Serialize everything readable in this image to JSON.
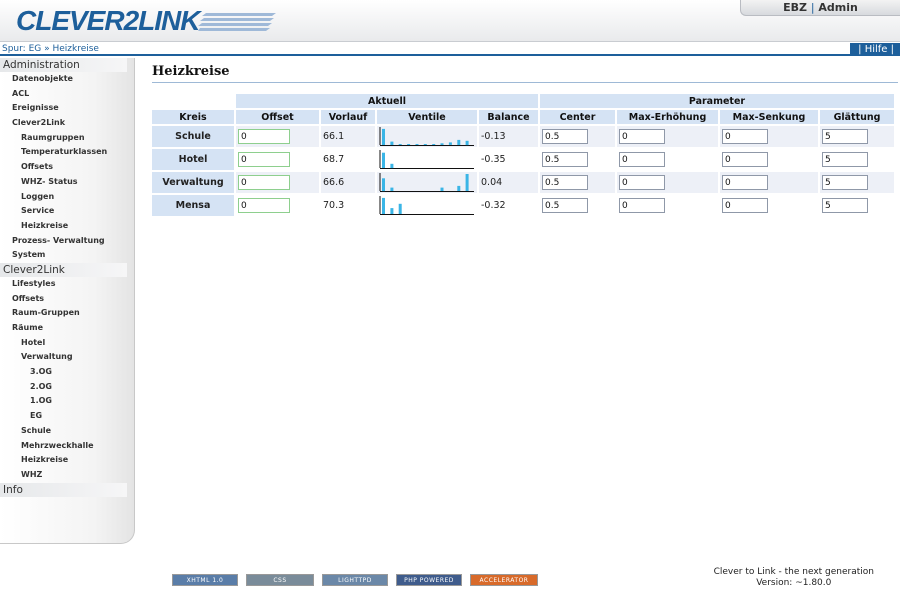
{
  "header": {
    "logo": "CLEVER2LINK",
    "user_org": "EBZ",
    "user_sep": "|",
    "user_role": "Admin",
    "brand_color": "#1d5f9b"
  },
  "breadcrumb": "Spur: EG » Heizkreise",
  "help": "| Hilfe |",
  "sidebar": {
    "admin": "Administration",
    "admin_items": {
      "datenobjekte": "Datenobjekte",
      "acl": "ACL",
      "ereignisse": "Ereignisse",
      "clever2link": "Clever2Link",
      "raumgruppen": "Raumgruppen",
      "temperaturklassen": "Temperaturklassen",
      "offsets": "Offsets",
      "whz_status": "WHZ- Status",
      "loggen": "Loggen",
      "service": "Service",
      "heizkreise": "Heizkreise",
      "prozess": "Prozess- Verwaltung",
      "system": "System"
    },
    "c2l": "Clever2Link",
    "c2l_items": {
      "lifestyles": "Lifestyles",
      "offsets": "Offsets",
      "raum_gruppen": "Raum-Gruppen",
      "raeume": "Räume",
      "hotel": "Hotel",
      "verwaltung": "Verwaltung",
      "og3": "3.OG",
      "og2": "2.OG",
      "og1": "1.OG",
      "eg": "EG",
      "schule": "Schule",
      "mehrzweckhalle": "Mehrzweckhalle",
      "heizkreise": "Heizkreise",
      "whz": "WHZ"
    },
    "info": "Info"
  },
  "main": {
    "title": "Heizkreise",
    "group_aktuell": "Aktuell",
    "group_parameter": "Parameter",
    "columns": {
      "kreis": "Kreis",
      "offset": "Offset",
      "vorlauf": "Vorlauf",
      "ventile": "Ventile",
      "balance": "Balance",
      "center": "Center",
      "max_erh": "Max-Erhöhung",
      "max_senk": "Max-Senkung",
      "glaettung": "Glättung"
    },
    "rows": [
      {
        "kreis": "Schule",
        "offset": "0",
        "vorlauf": "66.1",
        "balance": "-0.13",
        "center": "0.5",
        "max_erh": "0",
        "max_senk": "0",
        "glaettung": "5",
        "valves": [
          0.95,
          0.2,
          0.05,
          0.05,
          0.05,
          0.05,
          0.05,
          0.1,
          0.15,
          0.3,
          0.25
        ]
      },
      {
        "kreis": "Hotel",
        "offset": "0",
        "vorlauf": "68.7",
        "balance": "-0.35",
        "center": "0.5",
        "max_erh": "0",
        "max_senk": "0",
        "glaettung": "5",
        "valves": [
          0.9,
          0.25,
          0,
          0,
          0,
          0,
          0,
          0,
          0,
          0,
          0
        ]
      },
      {
        "kreis": "Verwaltung",
        "offset": "0",
        "vorlauf": "66.6",
        "balance": "0.04",
        "center": "0.5",
        "max_erh": "0",
        "max_senk": "0",
        "glaettung": "5",
        "valves": [
          0.75,
          0.2,
          0,
          0,
          0,
          0,
          0,
          0.2,
          0,
          0.3,
          1.0
        ]
      },
      {
        "kreis": "Mensa",
        "offset": "0",
        "vorlauf": "70.3",
        "balance": "-0.32",
        "center": "0.5",
        "max_erh": "0",
        "max_senk": "0",
        "glaettung": "5",
        "valves": [
          0.95,
          0.35,
          0.6,
          0,
          0,
          0,
          0,
          0,
          0,
          0,
          0
        ]
      }
    ]
  },
  "footer": {
    "badges": [
      "XHTML 1.0",
      "CSS",
      "LIGHTTPD",
      "PHP POWERED",
      "ACCELERATOR"
    ],
    "line1": "Clever to Link - the next generation",
    "line2": "Version: ~1.80.0"
  }
}
